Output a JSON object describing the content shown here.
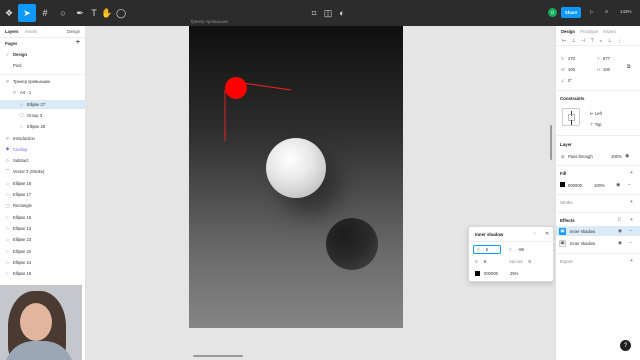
{
  "toolbar": {
    "tools": [
      "figma-menu-icon",
      "move-icon",
      "frame-icon",
      "shape-icon",
      "pen-icon",
      "text-icon",
      "comment-icon"
    ],
    "avatar_initial": "G",
    "share_label": "Share",
    "play_label": "▷",
    "a_label": "A",
    "zoom_label": "143%"
  },
  "left_panel": {
    "tabs": {
      "layers": "Layers",
      "assets": "Assets",
      "page_menu": "Design"
    },
    "pages_header": "Pages",
    "pages": [
      {
        "label": "Design",
        "selected": true
      },
      {
        "label": "Pool",
        "selected": false
      }
    ],
    "layers": [
      {
        "label": "Тренер превьюшек",
        "icon": "#",
        "indent": 0,
        "selected": false,
        "purple": false
      },
      {
        "label": "A4 - 1",
        "icon": "#",
        "indent": 1,
        "selected": false,
        "purple": false
      },
      {
        "label": "Ellipse 27",
        "icon": "○",
        "indent": 2,
        "selected": true,
        "purple": false
      },
      {
        "label": "Group 3",
        "icon": "▢",
        "indent": 2,
        "selected": false,
        "purple": false
      },
      {
        "label": "Ellipse 25",
        "icon": "○",
        "indent": 2,
        "selected": false,
        "purple": false
      },
      {
        "label": "Introduction",
        "icon": "#",
        "indent": 0,
        "selected": false,
        "purple": false
      },
      {
        "label": "Cooltop",
        "icon": "◆",
        "indent": 0,
        "selected": false,
        "purple": true
      },
      {
        "label": "Subtract",
        "icon": "◇",
        "indent": 0,
        "selected": false,
        "purple": false
      },
      {
        "label": "Vector 3 (Stroke)",
        "icon": "⌒",
        "indent": 0,
        "selected": false,
        "purple": false
      },
      {
        "label": "Ellipse 18",
        "icon": "○",
        "indent": 0,
        "selected": false,
        "purple": false
      },
      {
        "label": "Ellipse 17",
        "icon": "○",
        "indent": 0,
        "selected": false,
        "purple": false
      },
      {
        "label": "Rectangle",
        "icon": "▢",
        "indent": 0,
        "selected": false,
        "purple": false
      },
      {
        "label": "Ellipse 15",
        "icon": "○",
        "indent": 0,
        "selected": false,
        "purple": false
      },
      {
        "label": "Ellipse 13",
        "icon": "○",
        "indent": 0,
        "selected": false,
        "purple": false
      },
      {
        "label": "Ellipse 23",
        "icon": "○",
        "indent": 0,
        "selected": false,
        "purple": false
      },
      {
        "label": "Ellipse 22",
        "icon": "○",
        "indent": 0,
        "selected": false,
        "purple": false
      },
      {
        "label": "Ellipse 24",
        "icon": "○",
        "indent": 0,
        "selected": false,
        "purple": false
      },
      {
        "label": "Ellipse 19",
        "icon": "○",
        "indent": 0,
        "selected": false,
        "purple": false
      }
    ]
  },
  "canvas": {
    "frame_label": "Тренер превьюшек"
  },
  "inner_shadow_popup": {
    "title": "Inner shadow",
    "x_value": "5",
    "y_label": "Y",
    "y_value": "-88",
    "blur_label": "B",
    "blur_value": "8",
    "spread_label": "Spread",
    "spread_value": "0",
    "color_hex": "000000",
    "opacity": "25%"
  },
  "right_panel": {
    "tabs": {
      "design": "Design",
      "prototype": "Prototype",
      "inspect": "Inspect"
    },
    "x_label": "X",
    "x_value": "270",
    "y_label": "Y",
    "y_value": "877",
    "w_label": "W",
    "w_value": "100",
    "h_label": "H",
    "h_value": "100",
    "rotation": "0°",
    "constraints_header": "Constraints",
    "constraint_h": "Left",
    "constraint_v": "Top",
    "layer_header": "Layer",
    "blend_mode": "Pass through",
    "layer_opacity": "100%",
    "fill_header": "Fill",
    "fill_hex": "000000",
    "fill_opacity": "100%",
    "stroke_header": "Stroke",
    "effects_header": "Effects",
    "effects": [
      {
        "label": "Inner shadow",
        "selected": true
      },
      {
        "label": "Inner shadow",
        "selected": false
      }
    ],
    "export_header": "Export",
    "help_label": "?"
  }
}
